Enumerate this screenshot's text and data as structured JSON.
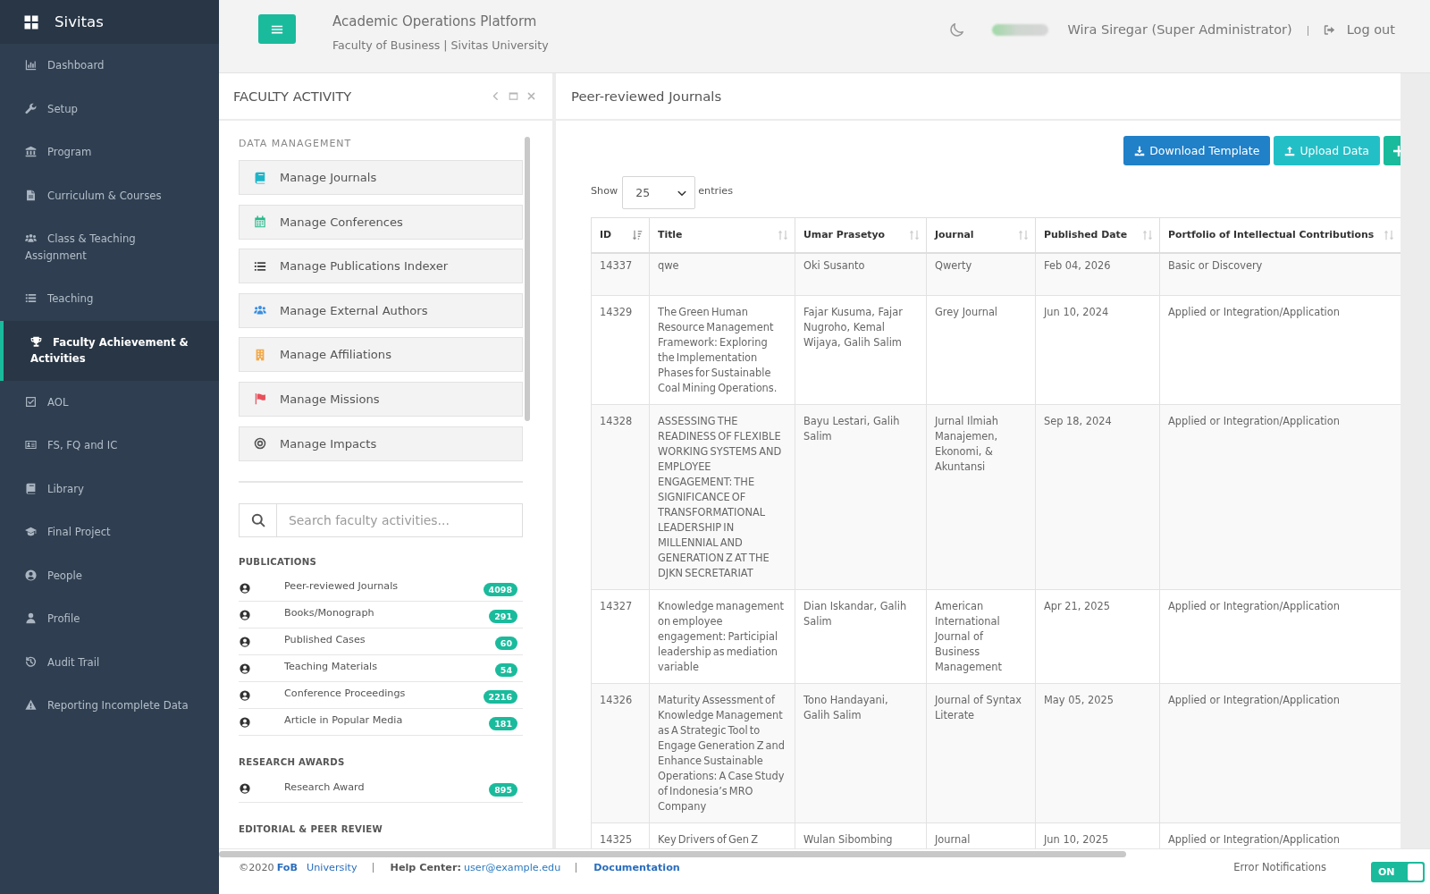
{
  "sidebar": {
    "brand": "Sivitas",
    "items": [
      {
        "label": "Dashboard",
        "selected": false
      },
      {
        "label": "Setup",
        "selected": false
      },
      {
        "label": "Program",
        "selected": false
      },
      {
        "label": "Curriculum & Courses",
        "selected": false
      },
      {
        "label": "Class & Teaching Assignment",
        "selected": false
      },
      {
        "label": "Teaching",
        "selected": false
      },
      {
        "label": "Faculty Achievement & Activities",
        "selected": true
      },
      {
        "label": "AOL",
        "selected": false
      },
      {
        "label": "FS, FQ and IC",
        "selected": false
      },
      {
        "label": "Library",
        "selected": false
      },
      {
        "label": "Final Project",
        "selected": false
      },
      {
        "label": "People",
        "selected": false
      },
      {
        "label": "Profile",
        "selected": false
      },
      {
        "label": "Audit Trail",
        "selected": false
      },
      {
        "label": "Reporting Incomplete Data",
        "selected": false
      }
    ]
  },
  "header": {
    "title": "Academic Operations Platform",
    "subtitle": "Faculty of Business | Sivitas University",
    "user_name": "Wira Siregar (Super Administrator)",
    "logout": "Log out"
  },
  "activity_panel": {
    "title": "FACULTY ACTIVITY",
    "data_management": {
      "heading": "DATA MANAGEMENT",
      "items": [
        "Manage Journals",
        "Manage Conferences",
        "Manage Publications Indexer",
        "Manage External Authors",
        "Manage Affiliations",
        "Manage Missions",
        "Manage Impacts"
      ]
    },
    "search": {
      "placeholder": "Search faculty activities..."
    },
    "groups": [
      {
        "heading": "PUBLICATIONS",
        "items": [
          {
            "label": "Peer-reviewed Journals",
            "count": "4098"
          },
          {
            "label": "Books/Monograph",
            "count": "291"
          },
          {
            "label": "Published Cases",
            "count": "60"
          },
          {
            "label": "Teaching Materials",
            "count": "54"
          },
          {
            "label": "Conference Proceedings",
            "count": "2216"
          },
          {
            "label": "Article in Popular Media",
            "count": "181"
          }
        ]
      },
      {
        "heading": "RESEARCH AWARDS",
        "items": [
          {
            "label": "Research Award",
            "count": "895"
          }
        ]
      },
      {
        "heading": "EDITORIAL & PEER REVIEW"
      }
    ]
  },
  "journals_panel": {
    "title": "Peer-reviewed Journals",
    "actions": [
      {
        "kind": "download",
        "label": "Download Template"
      },
      {
        "kind": "upload",
        "label": "Upload Data"
      },
      {
        "kind": "add"
      }
    ],
    "length_menu": {
      "prefix": "Show",
      "value": "25",
      "suffix": "entries"
    },
    "table": {
      "columns": [
        {
          "label": "ID",
          "sorted": true
        },
        {
          "label": "Title",
          "sorted": false
        },
        {
          "label": "Umar Prasetyo",
          "sorted": false
        },
        {
          "label": "Journal",
          "sorted": false
        },
        {
          "label": "Published Date",
          "sorted": false
        },
        {
          "label": "Portfolio of Intellectual Contributions",
          "sorted": false
        }
      ],
      "rows": [
        [
          "14337",
          "qwe",
          "Oki Susanto",
          "Qwerty",
          "Feb 04, 2026",
          "Basic or Discovery"
        ],
        [
          "14329",
          "The Green Human Resource Management Framework: Exploring the Implementation Phases for Sustainable Coal Mining Operations.",
          "Fajar Kusuma, Fajar Nugroho, Kemal Wijaya, Galih Salim",
          "Grey Journal",
          "Jun 10, 2024",
          "Applied or Integration/Application"
        ],
        [
          "14328",
          "ASSESSING THE READINESS OF FLEXIBLE WORKING SYSTEMS AND EMPLOYEE ENGAGEMENT: THE SIGNIFICANCE OF TRANSFORMATIONAL LEADERSHIP IN MILLENNIAL AND GENERATION Z AT THE DJKN SECRETARIAT",
          "Bayu Lestari, Galih Salim",
          "Jurnal Ilmiah Manajemen, Ekonomi, & Akuntansi",
          "Sep 18, 2024",
          "Applied or Integration/Application"
        ],
        [
          "14327",
          "Knowledge management on employee engagement: Participial leadership as mediation variable",
          "Dian Iskandar, Galih Salim",
          "American International Journal of Business Management",
          "Apr 21, 2025",
          "Applied or Integration/Application"
        ],
        [
          "14326",
          "Maturity Assessment of Knowledge Management as A Strategic Tool to Engage Generation Z and Enhance Sustainable Operations: A Case Study of Indonesia’s MRO Company",
          "Tono Handayani, Galih Salim",
          "Journal of Syntax Literate",
          "May 05, 2025",
          "Applied or Integration/Application"
        ],
        [
          "14325",
          "Key Drivers of Gen Z",
          "Wulan Sibombing",
          "Journal",
          "Jun 10, 2025",
          "Applied or Integration/Application"
        ]
      ]
    }
  },
  "footer": {
    "copyright": "©2020",
    "org": "FoB",
    "university": "University",
    "help_label": "Help Center:",
    "help_email": "user@example.edu",
    "docs": "Documentation",
    "error_notifications": {
      "label": "Error Notifications",
      "toggle_label": "ON",
      "on": true
    }
  }
}
